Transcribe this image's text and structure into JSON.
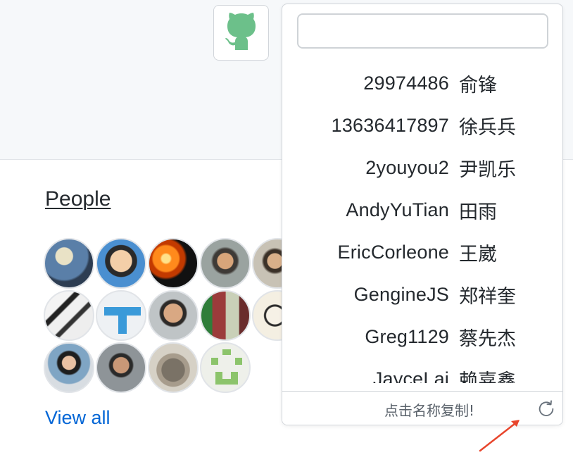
{
  "icons": {
    "extension": "github-octocat-icon",
    "refresh": "refresh-icon",
    "annotation": "red-arrow-icon"
  },
  "colors": {
    "octocat": "#6cc08a",
    "link": "#0366d6",
    "annotation_arrow": "#e8452c",
    "band": "#f6f8fa"
  },
  "people": {
    "heading": "People",
    "view_all": "View all",
    "avatar_count": 14
  },
  "popup": {
    "search_value": "",
    "members": [
      {
        "login": "29974486",
        "name": "俞锋"
      },
      {
        "login": "13636417897",
        "name": "徐兵兵"
      },
      {
        "login": "2youyou2",
        "name": "尹凯乐"
      },
      {
        "login": "AndyYuTian",
        "name": "田雨"
      },
      {
        "login": "EricCorleone",
        "name": "王崴"
      },
      {
        "login": "GengineJS",
        "name": "郑祥奎"
      },
      {
        "login": "Greg1129",
        "name": "蔡先杰"
      },
      {
        "login": "JayceLai",
        "name": "赖嘉鑫"
      }
    ],
    "footer_hint": "点击名称复制!"
  }
}
